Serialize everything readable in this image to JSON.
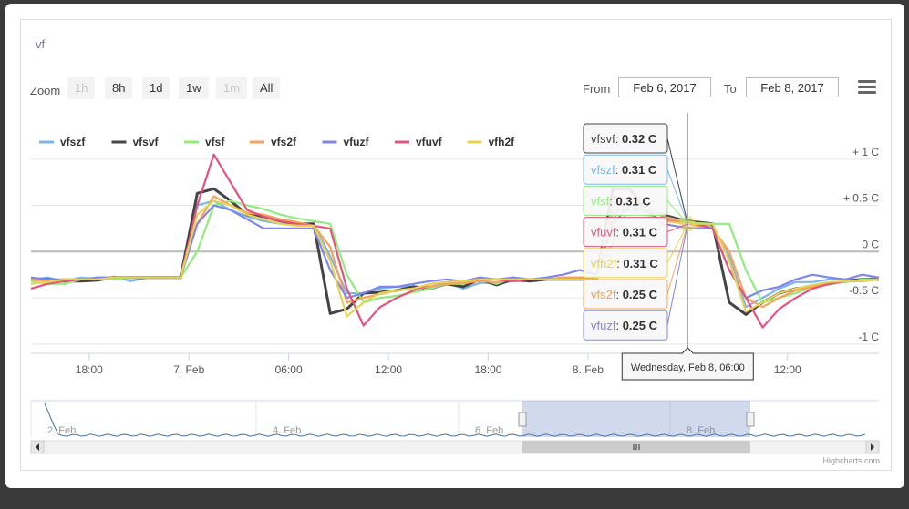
{
  "chart": {
    "title": "vf",
    "credits": "Highcharts.com"
  },
  "toolbar": {
    "zoom_label": "Zoom",
    "zoom_buttons": [
      {
        "label": "1h",
        "disabled": true
      },
      {
        "label": "8h",
        "disabled": false
      },
      {
        "label": "1d",
        "disabled": false
      },
      {
        "label": "1w",
        "disabled": false
      },
      {
        "label": "1m",
        "disabled": true
      },
      {
        "label": "All",
        "disabled": false
      }
    ],
    "from_label": "From",
    "from_value": "Feb 6, 2017",
    "to_label": "To",
    "to_value": "Feb 8, 2017"
  },
  "navigator": {
    "labels": [
      "2. Feb",
      "4. Feb",
      "6. Feb",
      "8. Feb"
    ]
  },
  "tooltip": {
    "header": "Wednesday, Feb 8, 06:00",
    "rows": [
      {
        "name": "vfsvf",
        "value": "0.32 C"
      },
      {
        "name": "vfszf",
        "value": "0.31 C"
      },
      {
        "name": "vfsf",
        "value": "0.31 C"
      },
      {
        "name": "vfuvf",
        "value": "0.31 C"
      },
      {
        "name": "vfh2f",
        "value": "0.31 C"
      },
      {
        "name": "vfs2f",
        "value": "0.25 C"
      },
      {
        "name": "vfuzf",
        "value": "0.25 C"
      }
    ]
  },
  "chart_data": {
    "type": "line",
    "x_labels": [
      "18:00",
      "7. Feb",
      "06:00",
      "12:00",
      "18:00",
      "8. Feb",
      "06:00",
      "12:00"
    ],
    "x_ticks_hours": [
      -6,
      0,
      6,
      12,
      18,
      24,
      30,
      36
    ],
    "xlim_hours": [
      -9.5,
      41.5
    ],
    "y_labels": [
      "+ 1 C",
      "+ 0.5 C",
      "0 C",
      "-0.5 C",
      "-1 C"
    ],
    "y_ticks": [
      1,
      0.5,
      0,
      -0.5,
      -1
    ],
    "ylim": [
      -1.1,
      1.5
    ],
    "x_unit": "hours from 7. Feb 00:00",
    "series": [
      {
        "name": "vfszf",
        "color": "#7cb5ec",
        "x": [
          -9.5,
          -8.5,
          -7.5,
          -6.5,
          -5.5,
          -4.5,
          -3.5,
          -2.5,
          -1.5,
          -0.5,
          0.5,
          1.5,
          2.5,
          3.5,
          4.5,
          5.5,
          6.5,
          7.5,
          8.5,
          9.5,
          10.5,
          11.5,
          12.5,
          13.5,
          14.5,
          15.5,
          16.5,
          17.5,
          18.5,
          19.5,
          20.5,
          21.5,
          22.5,
          23.5,
          24.5,
          25.5,
          26.5,
          27.5,
          28.5,
          29.5,
          30.5,
          31.5,
          32.5,
          33.5,
          34.5,
          35.5,
          36.5,
          37.5,
          38.5,
          39.5,
          40.5,
          41.5
        ],
        "y": [
          -0.3,
          -0.28,
          -0.32,
          -0.28,
          -0.3,
          -0.27,
          -0.32,
          -0.28,
          -0.28,
          -0.28,
          0.5,
          0.55,
          0.45,
          0.38,
          0.33,
          0.3,
          0.3,
          0.3,
          -0.05,
          -0.45,
          -0.45,
          -0.4,
          -0.38,
          -0.38,
          -0.38,
          -0.34,
          -0.4,
          -0.34,
          -0.34,
          -0.32,
          -0.32,
          -0.3,
          -0.3,
          -0.3,
          -0.3,
          0.45,
          0.45,
          0.44,
          0.33,
          0.32,
          0.31,
          0.28,
          -0.05,
          -0.6,
          -0.5,
          -0.4,
          -0.33,
          -0.33,
          -0.3,
          -0.3,
          -0.3,
          -0.28
        ]
      },
      {
        "name": "vfsvf",
        "color": "#434348",
        "x": [
          -9.5,
          -8.5,
          -7.5,
          -6.5,
          -5.5,
          -4.5,
          -3.5,
          -2.5,
          -1.5,
          -0.5,
          0.5,
          1.5,
          2.5,
          3.5,
          4.5,
          5.5,
          6.5,
          7.5,
          8.5,
          9.5,
          10.5,
          11.5,
          12.5,
          13.5,
          14.5,
          15.5,
          16.5,
          17.5,
          18.5,
          19.5,
          20.5,
          21.5,
          22.5,
          23.5,
          24.5,
          25.5,
          26.5,
          27.5,
          28.5,
          29.5,
          30.5,
          31.5,
          32.5,
          33.5,
          34.5,
          35.5,
          36.5,
          37.5,
          38.5,
          39.5,
          40.5,
          41.5
        ],
        "y": [
          -0.3,
          -0.3,
          -0.32,
          -0.32,
          -0.31,
          -0.28,
          -0.28,
          -0.28,
          -0.28,
          -0.28,
          0.63,
          0.68,
          0.55,
          0.4,
          0.38,
          0.33,
          0.3,
          0.3,
          -0.67,
          -0.62,
          -0.45,
          -0.44,
          -0.42,
          -0.38,
          -0.4,
          -0.35,
          -0.38,
          -0.3,
          -0.36,
          -0.3,
          -0.32,
          -0.3,
          -0.3,
          -0.3,
          -0.3,
          0.68,
          0.68,
          0.44,
          0.4,
          0.35,
          0.32,
          0.3,
          -0.55,
          -0.68,
          -0.55,
          -0.45,
          -0.4,
          -0.38,
          -0.35,
          -0.32,
          -0.3,
          -0.3
        ]
      },
      {
        "name": "vfsf",
        "color": "#90ed7d",
        "x": [
          -9.5,
          -8.5,
          -7.5,
          -6.5,
          -5.5,
          -4.5,
          -3.5,
          -2.5,
          -1.5,
          -0.5,
          0.5,
          1.5,
          2.5,
          3.5,
          4.5,
          5.5,
          6.5,
          7.5,
          8.5,
          9.5,
          10.5,
          11.5,
          12.5,
          13.5,
          14.5,
          15.5,
          16.5,
          17.5,
          18.5,
          19.5,
          20.5,
          21.5,
          22.5,
          23.5,
          24.5,
          25.5,
          26.5,
          27.5,
          28.5,
          29.5,
          30.5,
          31.5,
          32.5,
          33.5,
          34.5,
          35.5,
          36.5,
          37.5,
          38.5,
          39.5,
          40.5,
          41.5
        ],
        "y": [
          -0.32,
          -0.35,
          -0.35,
          -0.3,
          -0.3,
          -0.3,
          -0.28,
          -0.28,
          -0.28,
          -0.28,
          0.0,
          0.5,
          0.55,
          0.5,
          0.46,
          0.4,
          0.36,
          0.33,
          0.3,
          -0.25,
          -0.55,
          -0.5,
          -0.48,
          -0.44,
          -0.4,
          -0.35,
          -0.35,
          -0.3,
          -0.35,
          -0.28,
          -0.3,
          -0.3,
          -0.28,
          -0.28,
          -0.28,
          0.1,
          0.5,
          0.46,
          0.38,
          0.34,
          0.31,
          0.3,
          0.3,
          -0.2,
          -0.55,
          -0.5,
          -0.45,
          -0.38,
          -0.35,
          -0.33,
          -0.3,
          -0.3
        ]
      },
      {
        "name": "vfs2f",
        "color": "#f7a35c",
        "x": [
          -9.5,
          -8.5,
          -7.5,
          -6.5,
          -5.5,
          -4.5,
          -3.5,
          -2.5,
          -1.5,
          -0.5,
          0.5,
          1.5,
          2.5,
          3.5,
          4.5,
          5.5,
          6.5,
          7.5,
          8.5,
          9.5,
          10.5,
          11.5,
          12.5,
          13.5,
          14.5,
          15.5,
          16.5,
          17.5,
          18.5,
          19.5,
          20.5,
          21.5,
          22.5,
          23.5,
          24.5,
          25.5,
          26.5,
          27.5,
          28.5,
          29.5,
          30.5,
          31.5,
          32.5,
          33.5,
          34.5,
          35.5,
          36.5,
          37.5,
          38.5,
          39.5,
          40.5,
          41.5
        ],
        "y": [
          -0.3,
          -0.32,
          -0.3,
          -0.3,
          -0.28,
          -0.28,
          -0.28,
          -0.28,
          -0.28,
          -0.28,
          0.3,
          0.6,
          0.5,
          0.42,
          0.4,
          0.35,
          0.32,
          0.28,
          0.05,
          -0.55,
          -0.5,
          -0.46,
          -0.42,
          -0.4,
          -0.38,
          -0.35,
          -0.34,
          -0.32,
          -0.33,
          -0.3,
          -0.3,
          -0.3,
          -0.28,
          -0.28,
          -0.28,
          0.35,
          0.6,
          0.5,
          0.38,
          0.33,
          0.28,
          0.25,
          0.0,
          -0.5,
          -0.6,
          -0.5,
          -0.42,
          -0.38,
          -0.34,
          -0.32,
          -0.32,
          -0.3
        ]
      },
      {
        "name": "vfuzf",
        "color": "#8085e9",
        "x": [
          -9.5,
          -8.5,
          -7.5,
          -6.5,
          -5.5,
          -4.5,
          -3.5,
          -2.5,
          -1.5,
          -0.5,
          0.5,
          1.5,
          2.5,
          3.5,
          4.5,
          5.5,
          6.5,
          7.5,
          8.5,
          9.5,
          10.5,
          11.5,
          12.5,
          13.5,
          14.5,
          15.5,
          16.5,
          17.5,
          18.5,
          19.5,
          20.5,
          21.5,
          22.5,
          23.5,
          24.5,
          25.5,
          26.5,
          27.5,
          28.5,
          29.5,
          30.5,
          31.5,
          32.5,
          33.5,
          34.5,
          35.5,
          36.5,
          37.5,
          38.5,
          39.5,
          40.5,
          41.5
        ],
        "y": [
          -0.28,
          -0.3,
          -0.3,
          -0.3,
          -0.28,
          -0.28,
          -0.28,
          -0.28,
          -0.28,
          -0.28,
          0.3,
          0.5,
          0.45,
          0.35,
          0.25,
          0.25,
          0.25,
          0.25,
          -0.2,
          -0.5,
          -0.45,
          -0.38,
          -0.38,
          -0.35,
          -0.32,
          -0.3,
          -0.32,
          -0.28,
          -0.3,
          -0.28,
          -0.3,
          -0.28,
          -0.25,
          -0.2,
          -0.25,
          0.3,
          0.5,
          0.45,
          0.3,
          0.27,
          0.25,
          0.25,
          -0.2,
          -0.5,
          -0.42,
          -0.38,
          -0.3,
          -0.25,
          -0.28,
          -0.3,
          -0.25,
          -0.28
        ]
      },
      {
        "name": "vfuvf",
        "color": "#e4547f",
        "x": [
          -9.5,
          -8.5,
          -7.5,
          -6.5,
          -5.5,
          -4.5,
          -3.5,
          -2.5,
          -1.5,
          -0.5,
          0.5,
          1.5,
          2.5,
          3.5,
          4.5,
          5.5,
          6.5,
          7.5,
          8.5,
          9.5,
          10.5,
          11.5,
          12.5,
          13.5,
          14.5,
          15.5,
          16.5,
          17.5,
          18.5,
          19.5,
          20.5,
          21.5,
          22.5,
          23.5,
          24.5,
          25.5,
          26.5,
          27.5,
          28.5,
          29.5,
          30.5,
          31.5,
          32.5,
          33.5,
          34.5,
          35.5,
          36.5,
          37.5,
          38.5,
          39.5,
          40.5,
          41.5
        ],
        "y": [
          -0.4,
          -0.35,
          -0.32,
          -0.3,
          -0.3,
          -0.28,
          -0.28,
          -0.28,
          -0.28,
          -0.28,
          0.5,
          1.05,
          0.75,
          0.45,
          0.38,
          0.33,
          0.3,
          0.28,
          0.25,
          -0.4,
          -0.8,
          -0.6,
          -0.5,
          -0.42,
          -0.35,
          -0.33,
          -0.32,
          -0.3,
          -0.3,
          -0.32,
          -0.3,
          -0.3,
          -0.3,
          -0.3,
          -0.3,
          0.6,
          0.55,
          0.4,
          0.35,
          0.31,
          0.3,
          0.25,
          -0.2,
          -0.5,
          -0.82,
          -0.62,
          -0.5,
          -0.4,
          -0.35,
          -0.32,
          -0.32,
          -0.3
        ]
      },
      {
        "name": "vfh2f",
        "color": "#e4d354",
        "x": [
          -9.5,
          -8.5,
          -7.5,
          -6.5,
          -5.5,
          -4.5,
          -3.5,
          -2.5,
          -1.5,
          -0.5,
          0.5,
          1.5,
          2.5,
          3.5,
          4.5,
          5.5,
          6.5,
          7.5,
          8.5,
          9.5,
          10.5,
          11.5,
          12.5,
          13.5,
          14.5,
          15.5,
          16.5,
          17.5,
          18.5,
          19.5,
          20.5,
          21.5,
          22.5,
          23.5,
          24.5,
          25.5,
          26.5,
          27.5,
          28.5,
          29.5,
          30.5,
          31.5,
          32.5,
          33.5,
          34.5,
          35.5,
          36.5,
          37.5,
          38.5,
          39.5,
          40.5,
          41.5
        ],
        "y": [
          -0.35,
          -0.33,
          -0.3,
          -0.3,
          -0.3,
          -0.28,
          -0.28,
          -0.28,
          -0.28,
          -0.28,
          0.4,
          0.55,
          0.5,
          0.4,
          0.35,
          0.3,
          0.28,
          0.28,
          -0.1,
          -0.7,
          -0.55,
          -0.45,
          -0.42,
          -0.4,
          -0.35,
          -0.33,
          -0.32,
          -0.3,
          -0.3,
          -0.3,
          -0.3,
          -0.3,
          -0.3,
          -0.3,
          -0.3,
          0.5,
          0.55,
          0.4,
          0.33,
          0.31,
          0.3,
          0.3,
          -0.1,
          -0.65,
          -0.55,
          -0.45,
          -0.4,
          -0.36,
          -0.33,
          -0.32,
          -0.32,
          -0.3
        ]
      }
    ],
    "hover_x_hours": 30,
    "grid": true,
    "legend_position": "top-left"
  }
}
